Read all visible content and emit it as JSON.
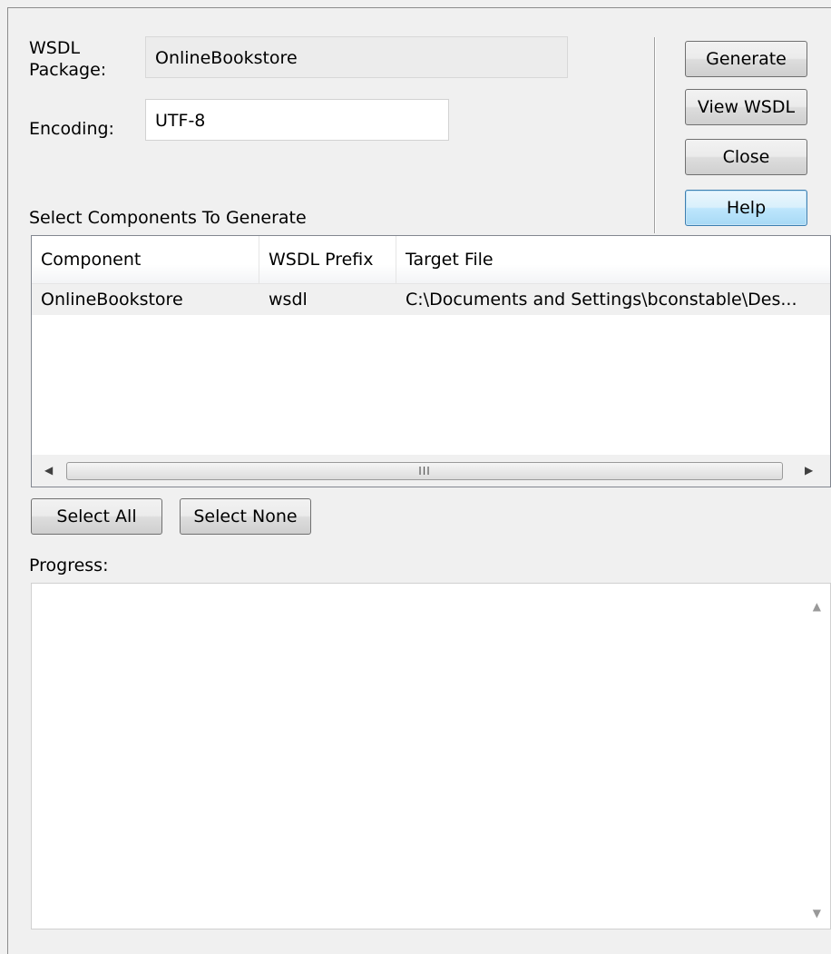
{
  "form": {
    "package_label": "WSDL\nPackage:",
    "package_label_line1": "WSDL",
    "package_label_line2": "Package:",
    "package_value": "OnlineBookstore",
    "encoding_label": "Encoding:",
    "encoding_value": "UTF-8"
  },
  "buttons": {
    "generate": "Generate",
    "view_wsdl": "View WSDL",
    "close": "Close",
    "help": "Help",
    "select_all": "Select All",
    "select_none": "Select None"
  },
  "components": {
    "section_label": "Select Components To Generate",
    "columns": [
      "Component",
      "WSDL Prefix",
      "Target File"
    ],
    "rows": [
      {
        "component": "OnlineBookstore",
        "prefix": "wsdl",
        "target_file": "C:\\Documents and Settings\\bconstable\\Des..."
      }
    ]
  },
  "progress": {
    "label": "Progress:",
    "text": ""
  },
  "icons": {
    "scroll_left": "scroll-left-arrow",
    "scroll_right": "scroll-right-arrow",
    "scroll_up": "scroll-up-arrow",
    "scroll_down": "scroll-down-arrow",
    "thumb_grip": "III"
  }
}
